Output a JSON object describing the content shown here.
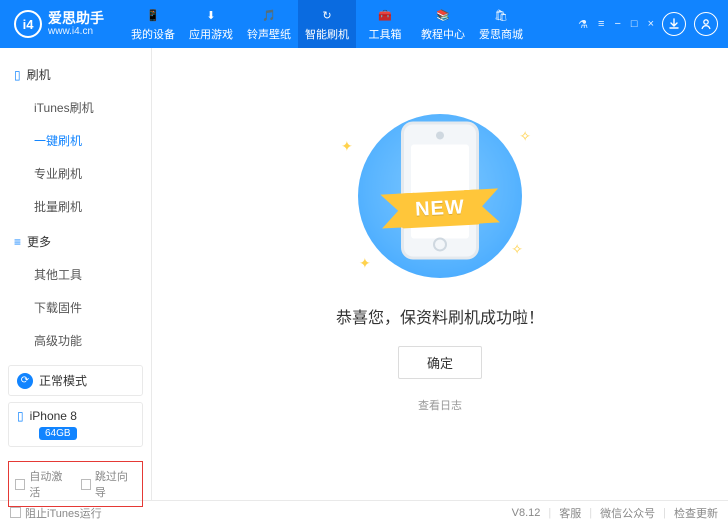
{
  "app": {
    "name": "爱思助手",
    "url": "www.i4.cn",
    "logo": "i4"
  },
  "window_controls": {
    "lock": "⚗",
    "menu": "≡",
    "min": "−",
    "max": "□",
    "close": "×"
  },
  "header_actions": {
    "download": "↓",
    "user": "👤"
  },
  "tabs": [
    {
      "icon": "📱",
      "label": "我的设备"
    },
    {
      "icon": "⬇",
      "label": "应用游戏"
    },
    {
      "icon": "🎵",
      "label": "铃声壁纸"
    },
    {
      "icon": "↻",
      "label": "智能刷机"
    },
    {
      "icon": "🧰",
      "label": "工具箱"
    },
    {
      "icon": "📚",
      "label": "教程中心"
    },
    {
      "icon": "🛍",
      "label": "爱思商城"
    }
  ],
  "active_tab_index": 3,
  "sidebar": {
    "group1": {
      "title": "刷机",
      "items": [
        "iTunes刷机",
        "一键刷机",
        "专业刷机",
        "批量刷机"
      ],
      "active_index": 1
    },
    "group2": {
      "title": "更多",
      "items": [
        "其他工具",
        "下载固件",
        "高级功能"
      ]
    }
  },
  "mode": {
    "label": "正常模式"
  },
  "device": {
    "name": "iPhone 8",
    "storage": "64GB"
  },
  "options": {
    "auto_activate": "自动激活",
    "skip_guide": "跳过向导"
  },
  "main": {
    "ribbon": "NEW",
    "success": "恭喜您，保资料刷机成功啦！",
    "ok": "确定",
    "view_log": "查看日志"
  },
  "status": {
    "block_itunes": "阻止iTunes运行",
    "version": "V8.12",
    "support": "客服",
    "wechat": "微信公众号",
    "check_update": "检查更新"
  }
}
